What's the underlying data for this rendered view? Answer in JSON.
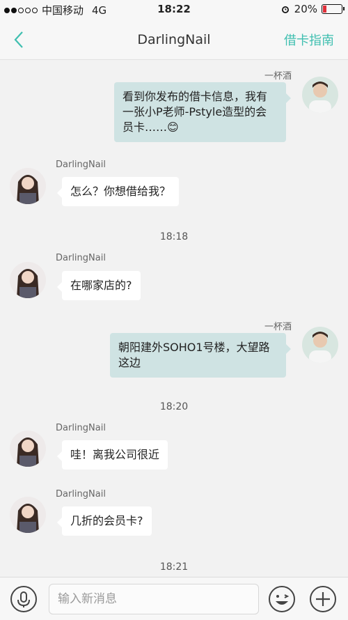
{
  "status_bar": {
    "carrier": "中国移动",
    "network": "4G",
    "time": "18:22",
    "battery_percent": "20%",
    "battery_level": 0.2,
    "signal_bars_filled": 2,
    "signal_bars_total": 5
  },
  "nav": {
    "title": "DarlingNail",
    "right_label": "借卡指南",
    "back_icon": "chevron-left-icon",
    "accent_color": "#3fbfb0"
  },
  "messages": [
    {
      "sender": "一杯酒",
      "text_lines": [
        "看到你发布的借卡信息，我有",
        "一张小P老师-Pstyle造型的会",
        "员卡……"
      ],
      "emoji": "😊"
    },
    {
      "sender": "DarlingNail",
      "text": "怎么？你想借给我？"
    },
    {
      "timestamp": "18:18"
    },
    {
      "sender": "DarlingNail",
      "text": "在哪家店的?"
    },
    {
      "sender": "一杯酒",
      "text_lines": [
        "朝阳建外SOHO1号楼，大望路",
        "这边"
      ]
    },
    {
      "timestamp": "18:20"
    },
    {
      "sender": "DarlingNail",
      "text": "哇！离我公司很近"
    },
    {
      "sender": "DarlingNail",
      "text": "几折的会员卡?"
    },
    {
      "timestamp": "18:21"
    }
  ],
  "input_bar": {
    "placeholder": "输入新消息",
    "icons": [
      "microphone-icon",
      "emoji-icon",
      "plus-icon"
    ]
  }
}
